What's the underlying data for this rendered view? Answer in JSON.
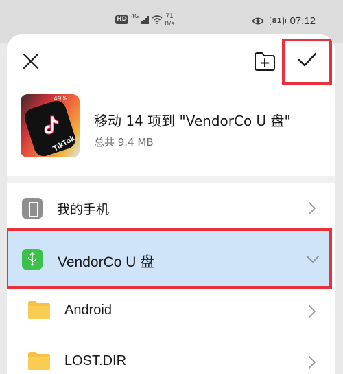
{
  "status_bar": {
    "hd": "HD",
    "network": "4G",
    "speed_value": "71",
    "speed_unit": "B/s",
    "battery": "81",
    "time": "07:12"
  },
  "dialog": {
    "title": "移动 14 项到 \"VendorCo U 盘\"",
    "subtitle": "总共 9.4 MB",
    "thumbnail_text": "TikTok",
    "thumbnail_percent": "49%"
  },
  "locations": [
    {
      "label": "我的手机",
      "icon": "phone-icon",
      "expanded": false
    },
    {
      "label": "VendorCo U 盘",
      "icon": "usb-icon",
      "expanded": true,
      "selected": true
    }
  ],
  "folders": [
    {
      "label": "Android",
      "icon": "folder-icon"
    },
    {
      "label": "LOST.DIR",
      "icon": "folder-icon"
    }
  ],
  "colors": {
    "selected_bg": "#cfe3f9",
    "highlight": "#e8313b",
    "usb_green": "#3cc24b",
    "folder_yellow": "#f7c143"
  }
}
